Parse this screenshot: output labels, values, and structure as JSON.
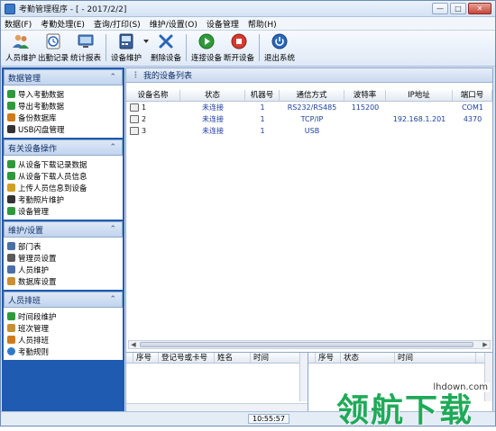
{
  "window": {
    "title": "考勤管理程序 - [ - 2017/2/2]"
  },
  "menu": [
    "数据(F)",
    "考勤处理(E)",
    "查询/打印(S)",
    "维护/设置(O)",
    "设备管理",
    "帮助(H)"
  ],
  "toolbar": [
    {
      "label": "人员维护",
      "icon": "users-icon"
    },
    {
      "label": "出勤记录",
      "icon": "clock-icon"
    },
    {
      "label": "统计报表",
      "icon": "monitor-icon"
    },
    {
      "label": "设备维护",
      "icon": "device-icon",
      "dropdown": true
    },
    {
      "label": "删除设备",
      "icon": "delete-icon"
    },
    {
      "label": "连接设备",
      "icon": "play-icon"
    },
    {
      "label": "断开设备",
      "icon": "stop-icon"
    },
    {
      "label": "退出系统",
      "icon": "power-icon"
    }
  ],
  "nav": [
    {
      "title": "数据管理",
      "items": [
        {
          "label": "导入考勤数据",
          "color": "#2f9a3a"
        },
        {
          "label": "导出考勤数据",
          "color": "#2f9a3a"
        },
        {
          "label": "备份数据库",
          "color": "#d07a1a"
        },
        {
          "label": "USB闪盘管理",
          "color": "#333333"
        }
      ]
    },
    {
      "title": "有关设备操作",
      "items": [
        {
          "label": "从设备下载记录数据",
          "color": "#2f9a3a"
        },
        {
          "label": "从设备下载人员信息",
          "color": "#2f9a3a"
        },
        {
          "label": "上传人员信息到设备",
          "color": "#d0a020"
        },
        {
          "label": "考勤照片维护",
          "color": "#333333"
        },
        {
          "label": "设备管理",
          "color": "#2f9a3a"
        }
      ]
    },
    {
      "title": "维护/设置",
      "items": [
        {
          "label": "部门表",
          "color": "#4a6fa8"
        },
        {
          "label": "管理员设置",
          "color": "#5a5a5a"
        },
        {
          "label": "人员维护",
          "color": "#4a6fa8"
        },
        {
          "label": "数据库设置",
          "color": "#c89030"
        }
      ]
    },
    {
      "title": "人员排班",
      "items": [
        {
          "label": "时间段维护",
          "color": "#2f9a3a"
        },
        {
          "label": "班次管理",
          "color": "#c89030"
        },
        {
          "label": "人员排班",
          "color": "#d07a1a"
        },
        {
          "label": "考勤规则",
          "color": "#2f7ac8"
        }
      ]
    }
  ],
  "device_list": {
    "title": "我的设备列表",
    "columns": [
      "设备名称",
      "状态",
      "机器号",
      "通信方式",
      "波特率",
      "IP地址",
      "端口号"
    ],
    "rows": [
      [
        "1",
        "未连接",
        "1",
        "RS232/RS485",
        "115200",
        "",
        "COM1"
      ],
      [
        "2",
        "未连接",
        "1",
        "TCP/IP",
        "",
        "192.168.1.201",
        "4370"
      ],
      [
        "3",
        "未连接",
        "1",
        "USB",
        "",
        "",
        ""
      ]
    ]
  },
  "record_panel": {
    "columns": [
      "序号",
      "登记号或卡号",
      "姓名",
      "时间"
    ]
  },
  "log_panel": {
    "columns": [
      "序号",
      "状态",
      "时间"
    ]
  },
  "status": {
    "time": "10:55:57"
  },
  "watermark": {
    "big": "领航下载",
    "small": "lhdown.com"
  }
}
